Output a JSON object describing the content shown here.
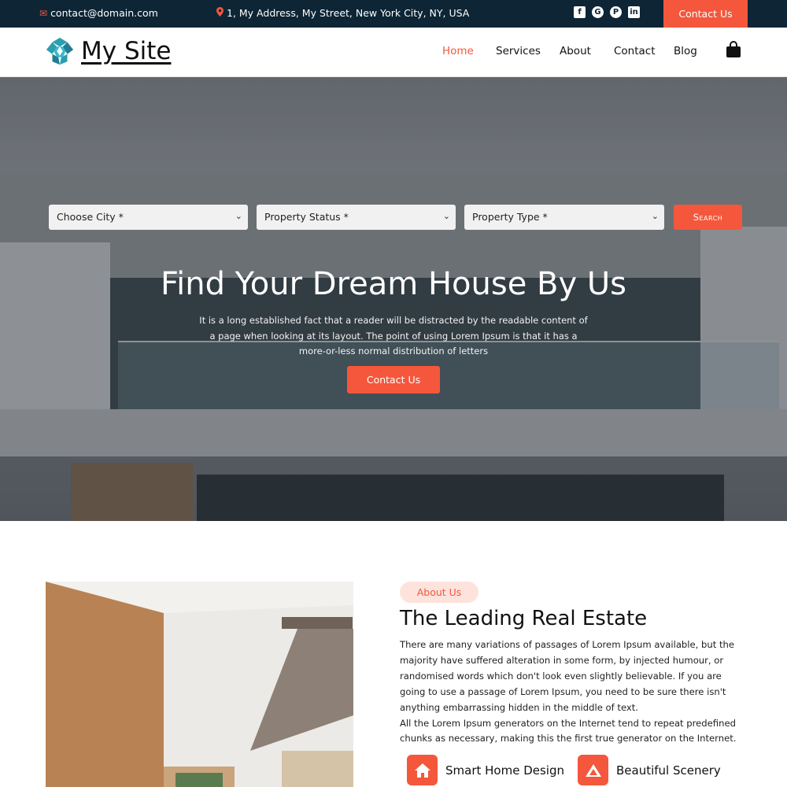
{
  "topbar": {
    "email": "contact@domain.com",
    "address": "1, My Address, My Street, New York City, NY, USA",
    "contact_button": "Contact Us",
    "social_icons": [
      "facebook-icon",
      "google-plus-icon",
      "pinterest-icon",
      "linkedin-icon"
    ]
  },
  "header": {
    "site_name": "My Site",
    "nav": [
      {
        "label": "Home",
        "active": true
      },
      {
        "label": "Services",
        "active": false
      },
      {
        "label": "About",
        "active": false
      },
      {
        "label": "Contact",
        "active": false
      },
      {
        "label": "Blog",
        "active": false
      }
    ],
    "cart_icon": "shopping-bag-icon"
  },
  "hero": {
    "filters": [
      {
        "selected": "Choose City *"
      },
      {
        "selected": "Property Status *"
      },
      {
        "selected": "Property Type *"
      }
    ],
    "search_button": "Search",
    "title": "Find Your Dream House By Us",
    "text": "It is a long established fact that a reader will be distracted by the readable content of a page when looking at its layout. The point of using Lorem Ipsum is that it has a more-or-less normal distribution of letters",
    "button": "Contact Us"
  },
  "about": {
    "badge": "About Us",
    "title": "The Leading Real Estate",
    "paragraph1": "There are many variations of passages of Lorem Ipsum available, but the majority have suffered alteration in some form, by injected humour, or randomised words which don't look even slightly believable. If you are going to use a passage of Lorem Ipsum, you need to be sure there isn't anything embarrassing hidden in the middle of text.",
    "paragraph2": "All the Lorem Ipsum generators on the Internet tend to repeat predefined chunks as necessary, making this the first true generator on the Internet.",
    "features": [
      {
        "label": "Smart Home Design",
        "icon": "home-icon"
      },
      {
        "label": "Beautiful Scenery",
        "icon": "mountain-icon"
      }
    ]
  },
  "colors": {
    "accent": "#f4573c",
    "topbar_bg": "#0d2535",
    "badge_bg": "#fde3dc"
  }
}
